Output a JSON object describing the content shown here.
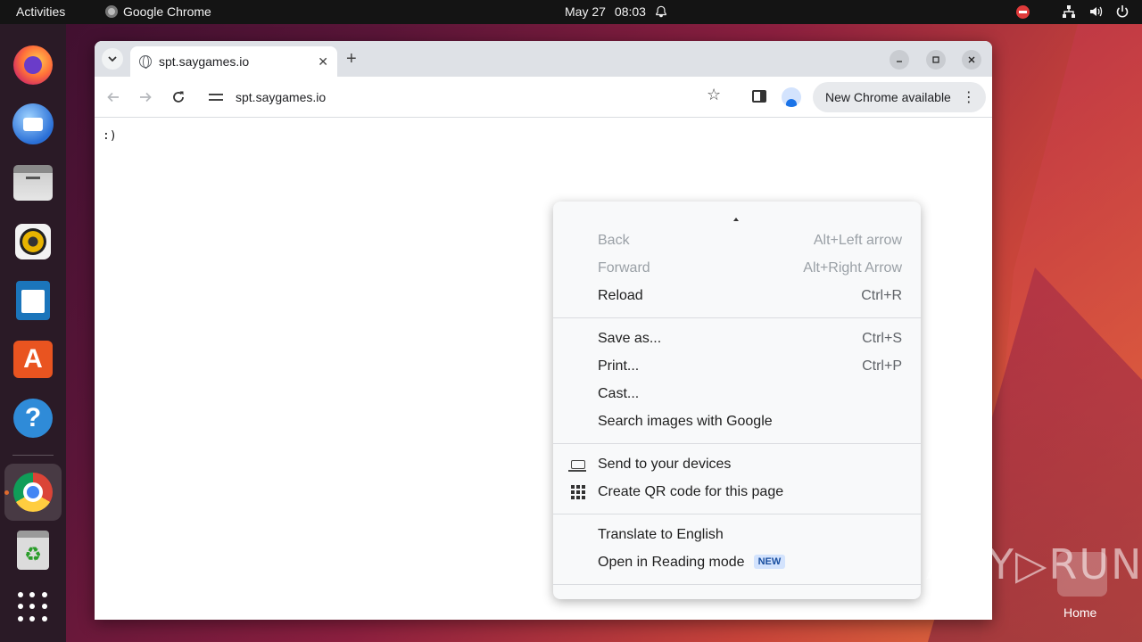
{
  "topbar": {
    "activities": "Activities",
    "app_name": "Google Chrome",
    "date": "May 27",
    "time": "08:03"
  },
  "dock": {
    "items": [
      "firefox",
      "thunderbird",
      "files",
      "rhythmbox",
      "libreoffice-writer",
      "app-center",
      "help",
      "google-chrome",
      "trash",
      "show-apps"
    ],
    "active": "google-chrome"
  },
  "browser": {
    "tab": {
      "title": "spt.saygames.io",
      "close": "✕"
    },
    "new_tab": "+",
    "omnibox": {
      "url": "spt.saygames.io"
    },
    "update_button": "New Chrome available",
    "page_text": ":)"
  },
  "context_menu": {
    "items": [
      {
        "label": "Back",
        "shortcut": "Alt+Left arrow",
        "enabled": false
      },
      {
        "label": "Forward",
        "shortcut": "Alt+Right Arrow",
        "enabled": false
      },
      {
        "label": "Reload",
        "shortcut": "Ctrl+R",
        "enabled": true
      },
      {
        "label": "Save as...",
        "shortcut": "Ctrl+S",
        "enabled": true
      },
      {
        "label": "Print...",
        "shortcut": "Ctrl+P",
        "enabled": true
      },
      {
        "label": "Cast...",
        "shortcut": "",
        "enabled": true
      },
      {
        "label": "Search images with Google",
        "shortcut": "",
        "enabled": true
      },
      {
        "label": "Send to your devices",
        "icon": "devices-icon",
        "enabled": true
      },
      {
        "label": "Create QR code for this page",
        "icon": "qr-code-icon",
        "enabled": true
      },
      {
        "label": "Translate to English",
        "enabled": true
      },
      {
        "label": "Open in Reading mode",
        "badge": "NEW",
        "enabled": true
      }
    ]
  },
  "desktop": {
    "watermark": "ANY▷RUN",
    "home_label": "Home"
  }
}
